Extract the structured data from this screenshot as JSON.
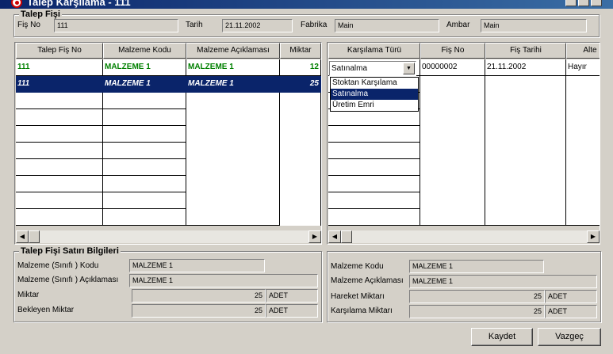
{
  "window": {
    "title": "Talep Karşılama - 111"
  },
  "header": {
    "legend": "Talep Fişi",
    "fis_no_label": "Fiş No",
    "fis_no": "111",
    "tarih_label": "Tarih",
    "tarih": "21.11.2002",
    "fabrika_label": "Fabrika",
    "fabrika": "Main",
    "ambar_label": "Ambar",
    "ambar": "Main"
  },
  "left_grid": {
    "columns": [
      "Talep Fiş No",
      "Malzeme Kodu",
      "Malzeme Açıklaması",
      "Miktar"
    ],
    "rows": [
      [
        "111",
        "MALZEME 1",
        "MALZEME 1",
        "12"
      ],
      [
        "111",
        "MALZEME 1",
        "MALZEME 1",
        "25"
      ]
    ]
  },
  "right_grid": {
    "columns": [
      "Karşılama Türü",
      "Fiş No",
      "Fiş Tarihi",
      "Alte"
    ],
    "rows": [
      [
        "Satınalma",
        "00000002",
        "21.11.2002",
        "Hayır"
      ]
    ],
    "dropdown_options": [
      "Stoktan Karşılama",
      "Satınalma",
      "Üretim Emri"
    ],
    "dropdown_selected": "Satınalma"
  },
  "left_detail": {
    "legend": "Talep Fişi Satırı Bilgileri",
    "kod_label": "Malzeme (Sınıfı ) Kodu",
    "kod": "MALZEME 1",
    "aciklama_label": "Malzeme (Sınıfı )  Açıklaması",
    "aciklama": "MALZEME 1",
    "miktar_label": "Miktar",
    "miktar": "25",
    "miktar_birim": "ADET",
    "bekleyen_label": "Bekleyen Miktar",
    "bekleyen": "25",
    "bekleyen_birim": "ADET"
  },
  "right_detail": {
    "kod_label": "Malzeme Kodu",
    "kod": "MALZEME 1",
    "aciklama_label": "Malzeme Açıklaması",
    "aciklama": "MALZEME 1",
    "hareket_label": "Hareket Miktarı",
    "hareket": "25",
    "hareket_birim": "ADET",
    "karsilama_label": "Karşılama Miktarı",
    "karsilama": "25",
    "karsilama_birim": "ADET"
  },
  "buttons": {
    "save": "Kaydet",
    "cancel": "Vazgeç"
  }
}
